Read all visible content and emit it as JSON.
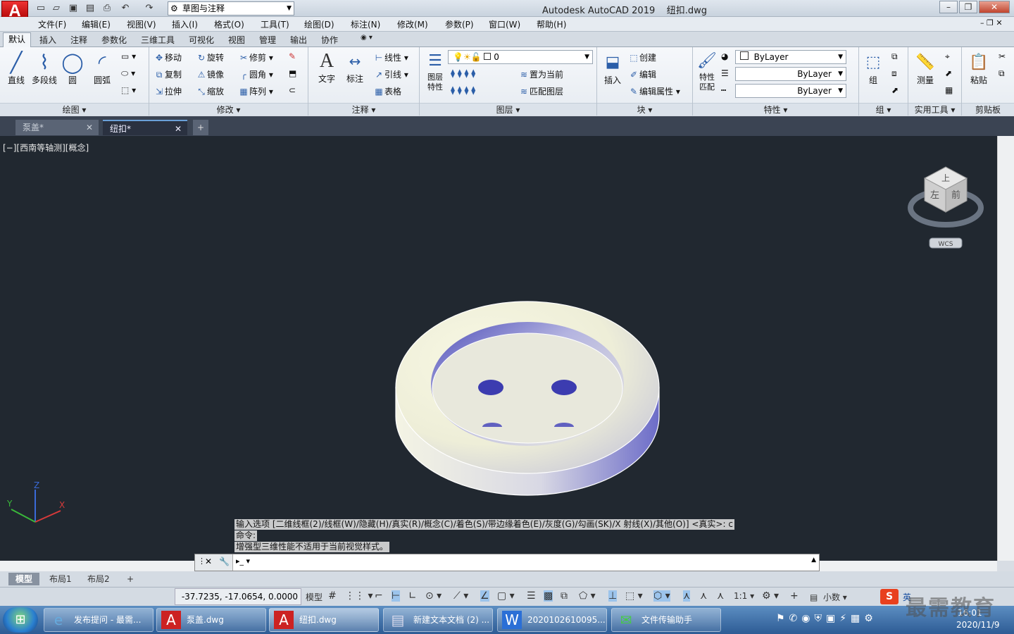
{
  "title": {
    "app": "Autodesk AutoCAD 2019",
    "file": "纽扣.dwg",
    "workspace": "草图与注释",
    "logo": "A"
  },
  "menu": [
    "文件(F)",
    "编辑(E)",
    "视图(V)",
    "插入(I)",
    "格式(O)",
    "工具(T)",
    "绘图(D)",
    "标注(N)",
    "修改(M)",
    "参数(P)",
    "窗口(W)",
    "帮助(H)"
  ],
  "ribbon_tabs": [
    "默认",
    "插入",
    "注释",
    "参数化",
    "三维工具",
    "可视化",
    "视图",
    "管理",
    "输出",
    "协作"
  ],
  "panels": {
    "draw": {
      "title": "绘图",
      "items": [
        "直线",
        "多段线",
        "圆",
        "圆弧"
      ]
    },
    "modify": {
      "title": "修改",
      "items": [
        "移动",
        "旋转",
        "修剪",
        "复制",
        "镜像",
        "圆角",
        "拉伸",
        "缩放",
        "阵列"
      ]
    },
    "annotate": {
      "title": "注释",
      "items": [
        "文字",
        "标注",
        "线性",
        "引线",
        "表格"
      ]
    },
    "layers": {
      "title": "图层",
      "items": [
        "图层\n特性",
        "置为当前",
        "匹配图层"
      ],
      "current": "0"
    },
    "block": {
      "title": "块",
      "items": [
        "插入",
        "创建",
        "编辑",
        "编辑属性"
      ]
    },
    "properties": {
      "title": "特性",
      "match": "特性\n匹配",
      "color": "ByLayer",
      "linetype": "ByLayer",
      "lineweight": "ByLayer"
    },
    "group": {
      "title": "组",
      "item": "组"
    },
    "utilities": {
      "title": "实用工具",
      "item": "测量"
    },
    "clipboard": {
      "title": "剪贴板",
      "item": "粘贴"
    }
  },
  "doc_tabs": [
    "泵盖*",
    "纽扣*"
  ],
  "viewport": {
    "label": "[−][西南等轴测][概念]",
    "viewcube": {
      "top": "上",
      "left": "左",
      "front": "前",
      "wcs": "WCS"
    },
    "ucs": {
      "x": "X",
      "y": "Y",
      "z": "Z"
    }
  },
  "command": {
    "history": [
      "输入选项 [二维线框(2)/线框(W)/隐藏(H)/真实(R)/概念(C)/着色(S)/带边缘着色(E)/灰度(G)/勾画(SK)/X 射线(X)/其他(O)] <真实>: c",
      "命令:",
      "增强型三维性能不适用于当前视觉样式。"
    ],
    "prompt": ""
  },
  "layout_tabs": [
    "模型",
    "布局1",
    "布局2"
  ],
  "status": {
    "coords": "-37.7235, -17.0654, 0.0000",
    "mode": "模型",
    "scale": "1:1",
    "units": "小数"
  },
  "taskbar": {
    "items": [
      {
        "label": "发布提问 - 最需...",
        "icon": "ie-icon"
      },
      {
        "label": "泵盖.dwg",
        "icon": "autocad-icon"
      },
      {
        "label": "纽扣.dwg",
        "icon": "autocad-icon"
      },
      {
        "label": "新建文本文档 (2) ...",
        "icon": "notepad-icon"
      },
      {
        "label": "2020102610095...",
        "icon": "word-icon"
      },
      {
        "label": "文件传输助手",
        "icon": "wechat-icon"
      }
    ],
    "ime": "英",
    "time": "16:01",
    "date": "2020/11/9"
  },
  "watermark": "最需教育",
  "colors": {
    "viewport_bg": "#212830",
    "accent": "#2b5ea8"
  }
}
